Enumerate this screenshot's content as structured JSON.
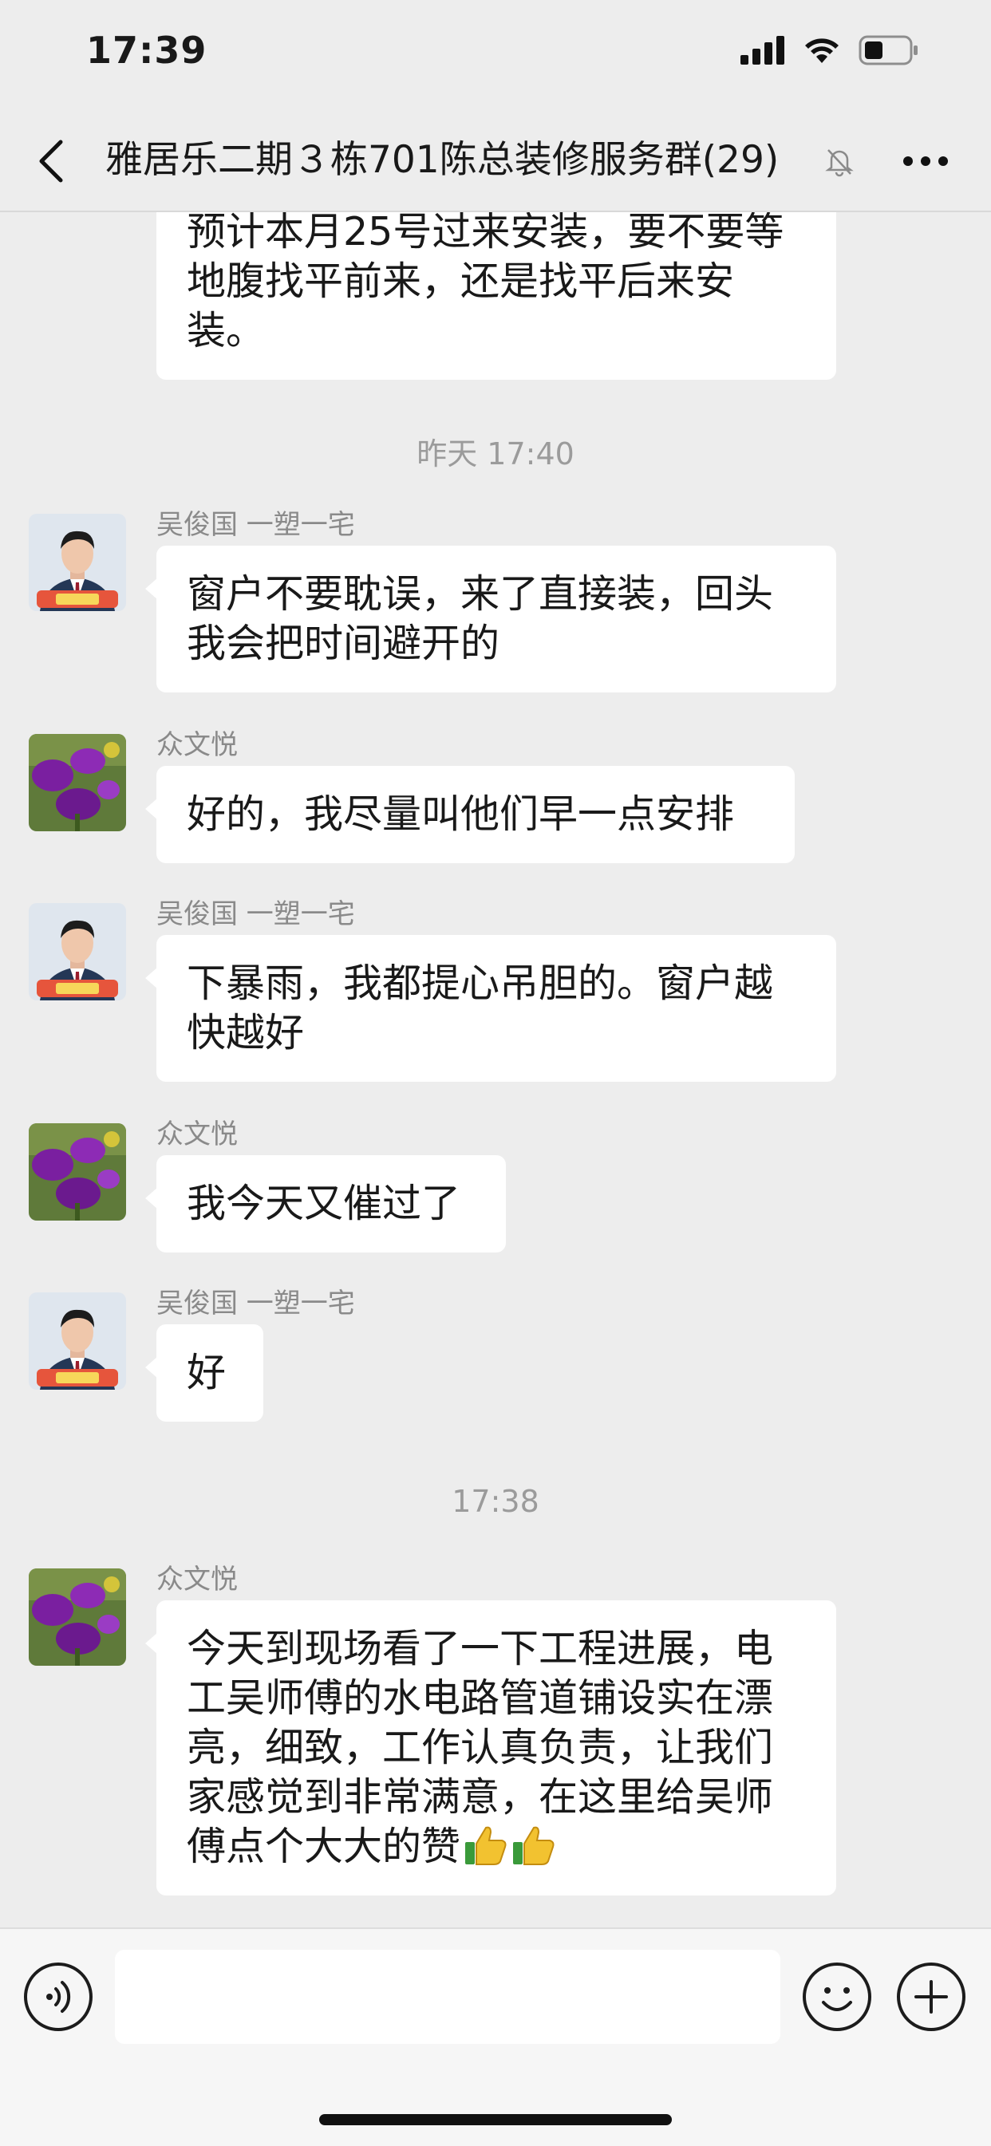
{
  "status_bar": {
    "time": "17:39"
  },
  "header": {
    "title": "雅居乐二期３栋701陈总装修服务群",
    "member_count": "(29)"
  },
  "messages": [
    {
      "type": "partial",
      "text": "预计本月25号过来安装，要不要等地腹找平前来，还是找平后来安装。"
    },
    {
      "type": "timestamp",
      "text": "昨天 17:40"
    },
    {
      "type": "msg",
      "sender": "吴俊国 一塑一宅",
      "avatar": "man-avatar",
      "text": "窗户不要耽误，来了直接装，回头我会把时间避开的"
    },
    {
      "type": "msg",
      "sender": "众文悦",
      "avatar": "flower-avatar",
      "text": "好的，我尽量叫他们早一点安排"
    },
    {
      "type": "msg",
      "sender": "吴俊国 一塑一宅",
      "avatar": "man-avatar",
      "text": "下暴雨，我都提心吊胆的。窗户越快越好"
    },
    {
      "type": "msg",
      "sender": "众文悦",
      "avatar": "flower-avatar",
      "text": "我今天又催过了"
    },
    {
      "type": "msg",
      "sender": "吴俊国 一塑一宅",
      "avatar": "man-avatar",
      "text": "好"
    },
    {
      "type": "timestamp",
      "text": "17:38"
    },
    {
      "type": "msg",
      "sender": "众文悦",
      "avatar": "flower-avatar",
      "text": "今天到现场看了一下工程进展，电工吴师傅的水电路管道铺设实在漂亮，细致，工作认真负责，让我们家感觉到非常满意，在这里给吴师傅点个大大的赞",
      "emoji": [
        "thumbs-up",
        "thumbs-up"
      ]
    }
  ],
  "colors": {
    "background": "#ededed",
    "bubble": "#ffffff",
    "timestamp": "#9b9b9b"
  }
}
